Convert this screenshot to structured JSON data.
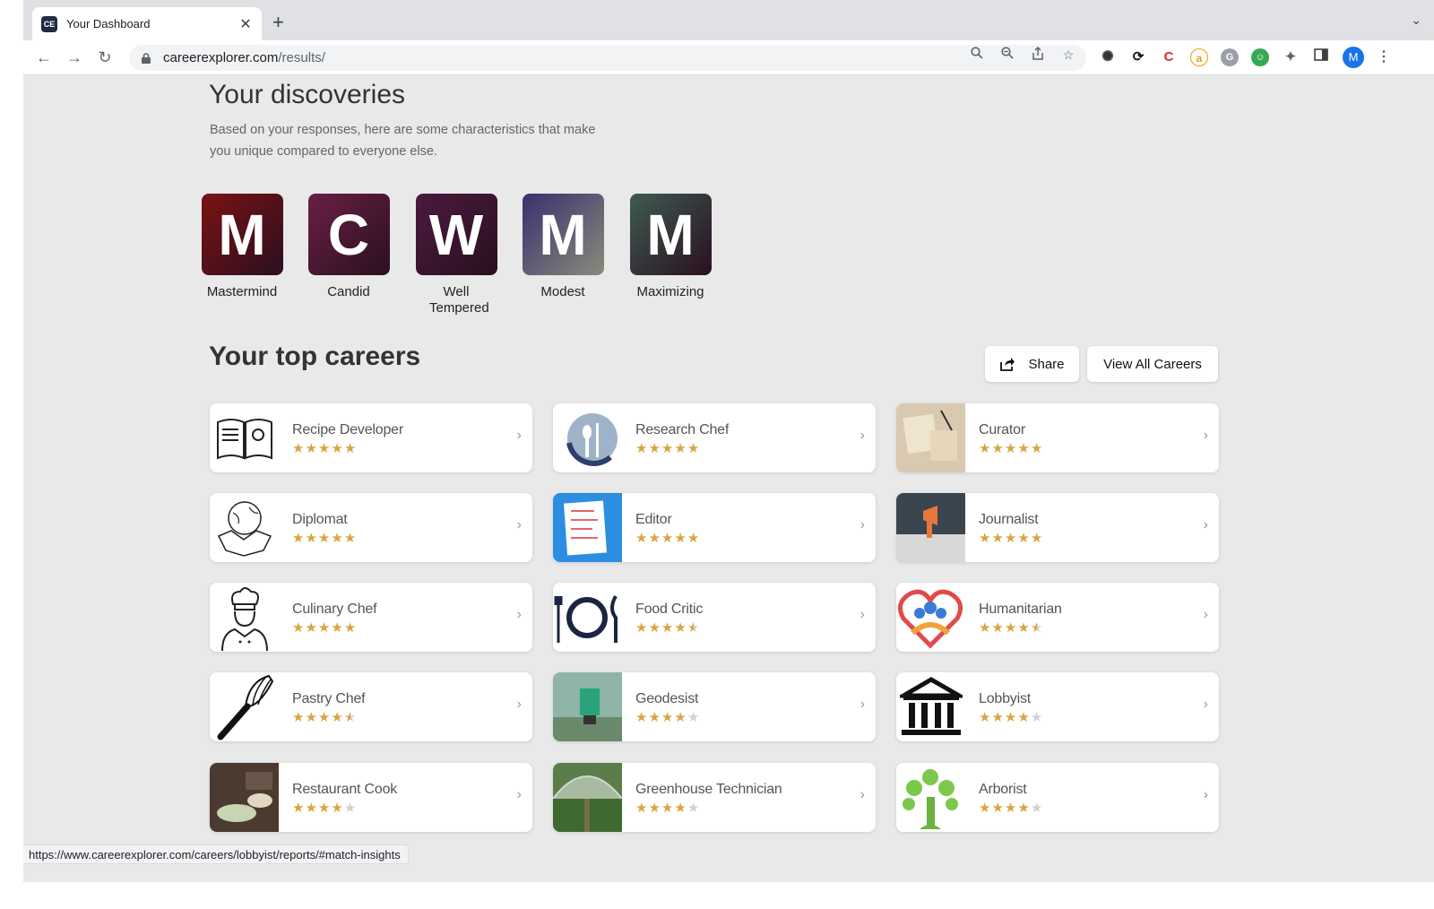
{
  "browser": {
    "tab_title": "Your Dashboard",
    "favicon_text": "CE",
    "url_host": "careerexplorer.com",
    "url_path": "/results/",
    "profile_initial": "M",
    "status_url": "https://www.careerexplorer.com/careers/lobbyist/reports/#match-insights"
  },
  "discoveries": {
    "title": "Your discoveries",
    "description": "Based on your responses, here are some characteristics that make you unique compared to everyone else.",
    "traits": [
      {
        "letter": "M",
        "label": "Mastermind",
        "color": "#7a1212"
      },
      {
        "letter": "C",
        "label": "Candid",
        "color": "#6a1f45"
      },
      {
        "letter": "W",
        "label": "Well Tempered",
        "color": "#4a1a3e"
      },
      {
        "letter": "M",
        "label": "Modest",
        "color": "#3a2f6e"
      },
      {
        "letter": "M",
        "label": "Maximizing",
        "color": "#3f5a52"
      }
    ]
  },
  "careers": {
    "title": "Your top careers",
    "share_label": "Share",
    "view_all_label": "View All Careers",
    "items": [
      {
        "name": "Recipe Developer",
        "rating": 5,
        "icon": "recipe-book-icon"
      },
      {
        "name": "Research Chef",
        "rating": 5,
        "icon": "fork-spoon-icon"
      },
      {
        "name": "Curator",
        "rating": 5,
        "icon": "curator-photo"
      },
      {
        "name": "Diplomat",
        "rating": 5,
        "icon": "handshake-globe-icon"
      },
      {
        "name": "Editor",
        "rating": 5,
        "icon": "document-icon"
      },
      {
        "name": "Journalist",
        "rating": 5,
        "icon": "megaphone-newspaper-icon"
      },
      {
        "name": "Culinary Chef",
        "rating": 5,
        "icon": "chef-icon"
      },
      {
        "name": "Food Critic",
        "rating": 4.5,
        "icon": "plate-utensils-icon"
      },
      {
        "name": "Humanitarian",
        "rating": 4.5,
        "icon": "heart-people-icon"
      },
      {
        "name": "Pastry Chef",
        "rating": 4.5,
        "icon": "whisk-icon"
      },
      {
        "name": "Geodesist",
        "rating": 4,
        "icon": "survey-instrument-photo"
      },
      {
        "name": "Lobbyist",
        "rating": 4,
        "icon": "government-building-icon"
      },
      {
        "name": "Restaurant Cook",
        "rating": 4,
        "icon": "kitchen-photo"
      },
      {
        "name": "Greenhouse Technician",
        "rating": 4,
        "icon": "greenhouse-photo"
      },
      {
        "name": "Arborist",
        "rating": 4,
        "icon": "tree-icon"
      }
    ]
  }
}
